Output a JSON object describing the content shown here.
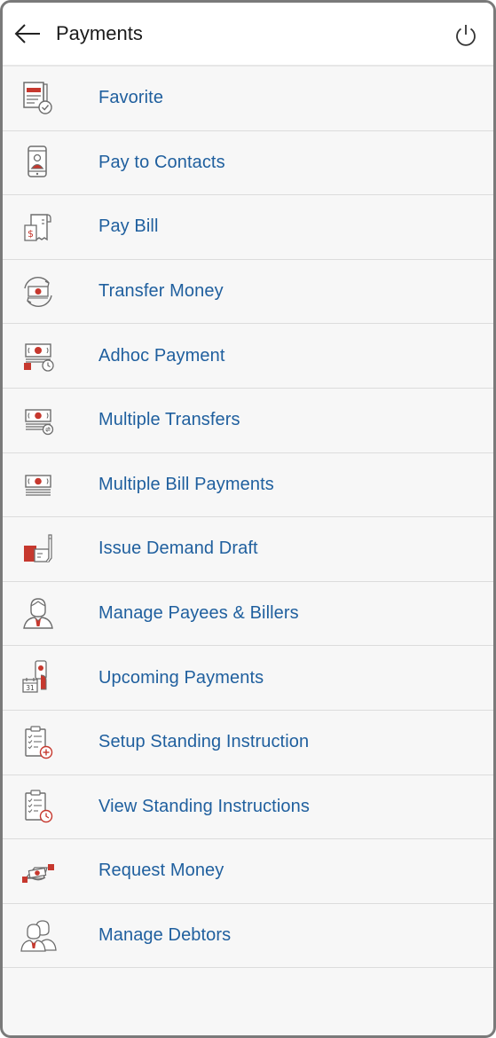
{
  "header": {
    "title": "Payments",
    "back_icon": "arrow-left-icon",
    "power_icon": "power-icon"
  },
  "colors": {
    "accent": "#1f5f9e",
    "icon_red": "#c6382e",
    "icon_gray": "#6d6d6d"
  },
  "menu": {
    "items": [
      {
        "label": "Favorite",
        "icon": "favorite-icon"
      },
      {
        "label": "Pay to Contacts",
        "icon": "pay-to-contacts-icon"
      },
      {
        "label": "Pay Bill",
        "icon": "pay-bill-icon"
      },
      {
        "label": "Transfer Money",
        "icon": "transfer-money-icon"
      },
      {
        "label": "Adhoc Payment",
        "icon": "adhoc-payment-icon"
      },
      {
        "label": "Multiple Transfers",
        "icon": "multiple-transfers-icon"
      },
      {
        "label": "Multiple Bill Payments",
        "icon": "multiple-bill-payments-icon"
      },
      {
        "label": "Issue Demand Draft",
        "icon": "issue-demand-draft-icon"
      },
      {
        "label": "Manage Payees & Billers",
        "icon": "manage-payees-icon"
      },
      {
        "label": "Upcoming Payments",
        "icon": "upcoming-payments-icon"
      },
      {
        "label": "Setup Standing Instruction",
        "icon": "setup-standing-instruction-icon"
      },
      {
        "label": "View Standing Instructions",
        "icon": "view-standing-instructions-icon"
      },
      {
        "label": "Request Money",
        "icon": "request-money-icon"
      },
      {
        "label": "Manage Debtors",
        "icon": "manage-debtors-icon"
      }
    ],
    "calendar_day": "31"
  }
}
